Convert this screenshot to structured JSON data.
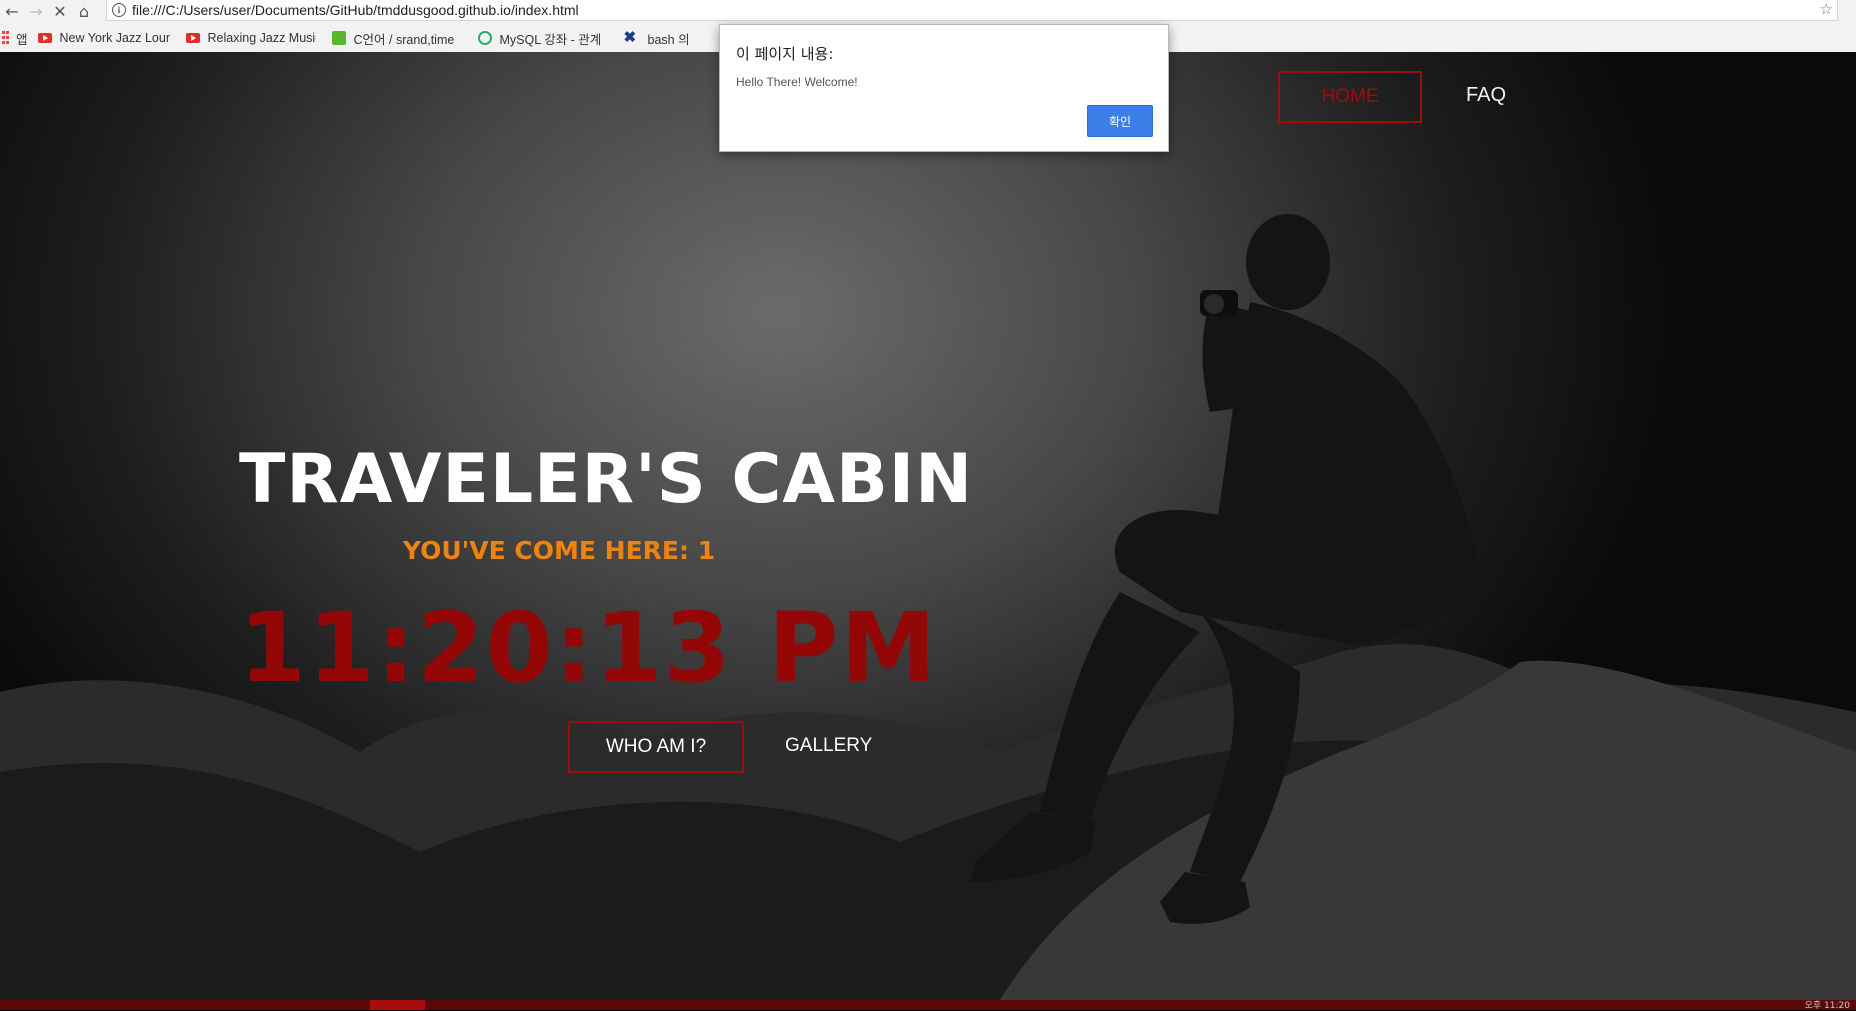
{
  "browser": {
    "url": "file:///C:/Users/user/Documents/GitHub/tmddusgood.github.io/index.html",
    "apps_label": "앱",
    "bookmarks": [
      {
        "label": "New York Jazz Loun",
        "icon": "youtube-icon"
      },
      {
        "label": "Relaxing Jazz Music",
        "icon": "youtube-icon"
      },
      {
        "label": "C언어 / srand,time",
        "icon": "blog-icon"
      },
      {
        "label": "MySQL 강좌 - 관계",
        "icon": "q-icon"
      },
      {
        "label": "bash 의",
        "icon": "x-icon"
      }
    ]
  },
  "nav": {
    "home": "HOME",
    "faq": "FAQ"
  },
  "hero": {
    "title": "TRAVELER'S CABIN",
    "visit_count": "YOU'VE COME HERE: 1",
    "clock": "11:20:13 PM",
    "who_button": "WHO AM I?",
    "gallery_link": "GALLERY"
  },
  "dialog": {
    "title": "이 페이지 내용:",
    "message": "Hello There! Welcome!",
    "ok_label": "확인"
  },
  "taskbar": {
    "time": "오후 11:20"
  },
  "colors": {
    "accent_red": "#9c0e0e",
    "clock_red": "#940707",
    "orange": "#f0830d",
    "dialog_button": "#3d7fe9"
  }
}
